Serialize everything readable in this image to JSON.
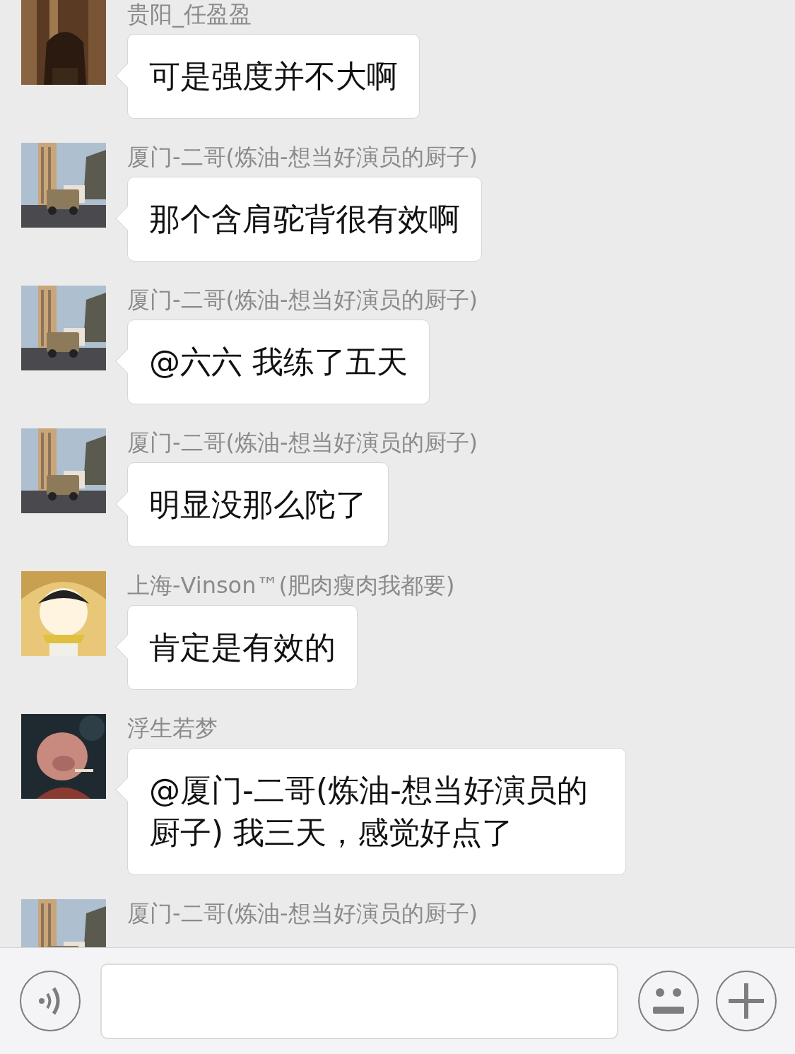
{
  "messages": [
    {
      "sender": "贵阳_任盈盈",
      "text": "可是强度并不大啊"
    },
    {
      "sender": "厦门-二哥(炼油-想当好演员的厨子)",
      "text": "那个含肩驼背很有效啊"
    },
    {
      "sender": "厦门-二哥(炼油-想当好演员的厨子)",
      "text": "@六六 我练了五天"
    },
    {
      "sender": "厦门-二哥(炼油-想当好演员的厨子)",
      "text": "明显没那么陀了"
    },
    {
      "sender": "上海-Vinson™(肥肉瘦肉我都要)",
      "text": "肯定是有效的"
    },
    {
      "sender": "浮生若梦",
      "text": "@厦门-二哥(炼油-想当好演员的厨子) 我三天，感觉好点了"
    },
    {
      "sender": "厦门-二哥(炼油-想当好演员的厨子)"
    }
  ]
}
